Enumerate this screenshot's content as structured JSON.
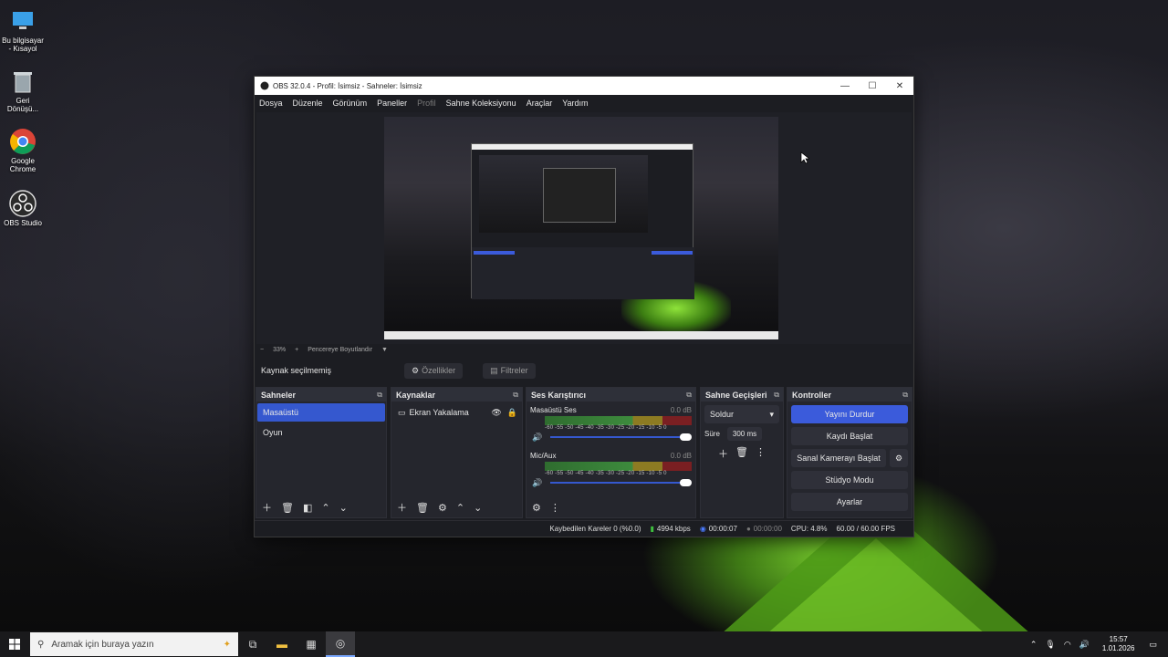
{
  "desktop": {
    "icons": [
      {
        "label": "Bu bilgisayar - Kısayol"
      },
      {
        "label": "Geri Dönüşü..."
      },
      {
        "label": "Google Chrome"
      },
      {
        "label": "OBS Studio"
      }
    ]
  },
  "window": {
    "title": "OBS 32.0.4 - Profil: İsimsiz - Sahneler: İsimsiz",
    "controls": {
      "minimize": "—",
      "maximize": "☐",
      "close": "✕"
    }
  },
  "menu": [
    "Dosya",
    "Düzenle",
    "Görünüm",
    "Paneller",
    "Profil",
    "Sahne Koleksiyonu",
    "Araçlar",
    "Yardım"
  ],
  "zoom": {
    "minus": "−",
    "value": "33%",
    "plus": "+",
    "fit": "Pencereye Boyutlandır",
    "caret": "▼"
  },
  "source_bar": {
    "status": "Kaynak seçilmemiş",
    "properties": "Özellikler",
    "filters": "Filtreler"
  },
  "scenes": {
    "title": "Sahneler",
    "items": [
      "Masaüstü",
      "Oyun"
    ],
    "selected": 0
  },
  "sources": {
    "title": "Kaynaklar",
    "items": [
      "Ekran Yakalama"
    ]
  },
  "mixer": {
    "title": "Ses Karıştırıcı",
    "ticks": "-60 -55 -50 -45 -40 -35 -30 -25 -20 -15 -10 -5 0",
    "channels": [
      {
        "name": "Masaüstü Ses",
        "db": "0.0 dB",
        "volume": 1.0
      },
      {
        "name": "Mic/Aux",
        "db": "0.0 dB",
        "volume": 1.0
      }
    ]
  },
  "transitions": {
    "title": "Sahne Geçişleri",
    "type": "Soldur",
    "duration_label": "Süre",
    "duration": "300 ms"
  },
  "controls": {
    "title": "Kontroller",
    "stop_stream": "Yayını Durdur",
    "start_record": "Kaydı Başlat",
    "virtual_cam": "Sanal Kamerayı Başlat",
    "studio_mode": "Stüdyo Modu",
    "settings": "Ayarlar"
  },
  "status": {
    "dropped": "Kaybedilen Kareler 0 (%0.0)",
    "bitrate": "4994 kbps",
    "stream_time": "00:00:07",
    "record_time": "00:00:00",
    "cpu": "CPU: 4.8%",
    "fps": "60.00 / 60.00 FPS"
  },
  "taskbar": {
    "search_placeholder": "Aramak için buraya yazın",
    "time": "15:57",
    "date": "1.01.2026"
  }
}
